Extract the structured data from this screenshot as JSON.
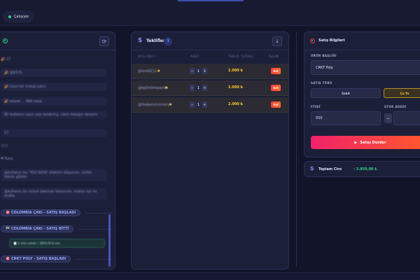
{
  "status": {
    "label": "Çalışıyor",
    "color": "#2fd47a"
  },
  "left": {
    "chat": [
      {
        "text": "🎉 17"
      },
      {
        "text": "🎉 @$%%"
      },
      {
        "text": "🎉 Uzun bir mesaj satırı"
      },
      {
        "text": "🎉 aaaaa  ...  Bbb kasa"
      },
      {
        "text": "Bir kullanıcı uzun yazı bırakmış, canlı mesajın devamı"
      },
      {
        "text": "17"
      },
      {
        "text": "🌕🌕"
      },
      {
        "text": "❤ Kasa"
      },
      {
        "text": "@kullanıcı bu 'YOU WON' efektini istiyorum, lütfen tekrar göster"
      },
      {
        "text": "@kullanıcı bu ürüne bakmak istiyorum, stokta var mı acaba"
      }
    ],
    "events": [
      {
        "icon": "🎯",
        "label": "COLOMBİA ÇAKI - SATIŞ BAŞLADI"
      },
      {
        "icon": "🏁",
        "label": "COLOMBİA ÇAKI - SATIŞ BİTTİ"
      },
      {
        "icon": "🎯",
        "label": "CRKT POLY - SATIŞ BAŞLADI"
      }
    ],
    "sale_summary": "🧾 2 ürün satıldı • 3850,00 ₺ ciro",
    "refresh_icon": "refresh-icon"
  },
  "offers": {
    "title": "Teklifler",
    "count": "3",
    "columns": [
      "KULLANICI",
      "ADET",
      "TEKLİF TUTARI",
      "İŞLEM"
    ],
    "rows": [
      {
        "user": "@lord4211",
        "qty": "1",
        "price": "2.000 ₺",
        "action": "Sat"
      },
      {
        "user": "@bgOnlinepanda",
        "qty": "1",
        "price": "2.000 ₺",
        "action": "Sat"
      },
      {
        "user": "@thebotvinsmany",
        "qty": "1",
        "price": "2.000 ₺",
        "action": "Sat"
      }
    ]
  },
  "sale_info": {
    "title": "Satış Bilgileri",
    "product_label": "ÜRÜN BAŞLIĞI",
    "product_value": "CRKT Poly",
    "type_label": "SATIŞ TÜRÜ",
    "type_options": [
      "Sabit",
      "Çu Ya"
    ],
    "price_label": "FİYAT",
    "price_value": "550",
    "stock_label": "STOK ADEDİ",
    "stock_value": "3",
    "stop_label": "Satışı Durdur"
  },
  "revenue": {
    "label": "Toplam Ciro",
    "value": ": 3.850,00 ₺"
  },
  "colors": {
    "accent": "#4a55b8",
    "gold": "#ffcc33",
    "danger": "#ff3b3b",
    "success": "#34d18a"
  }
}
